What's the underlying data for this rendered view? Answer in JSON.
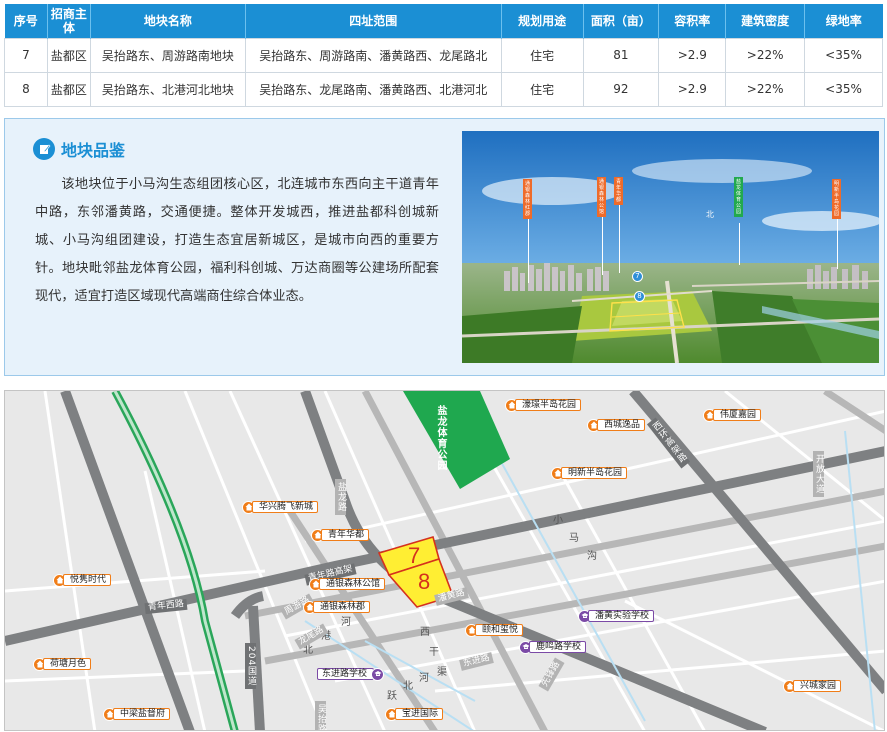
{
  "table": {
    "headers": [
      "序号",
      "招商主体",
      "地块名称",
      "四址范围",
      "规划用途",
      "面积（亩）",
      "容积率",
      "建筑密度",
      "绿地率"
    ],
    "rows": [
      [
        "7",
        "盐都区",
        "吴抬路东、周游路南地块",
        "吴抬路东、周游路南、潘黄路西、龙尾路北",
        "住宅",
        "81",
        ">2.9",
        ">22%",
        "<35%"
      ],
      [
        "8",
        "盐都区",
        "吴抬路东、北港河北地块",
        "吴抬路东、龙尾路南、潘黄路西、北港河北",
        "住宅",
        "92",
        ">2.9",
        ">22%",
        "<35%"
      ]
    ]
  },
  "appraisal": {
    "title": "地块品鉴",
    "icon": "edit-note-icon",
    "text": "该地块位于小马沟生态组团核心区，北连城市东西向主干道青年中路，东邻潘黄路，交通便捷。整体开发城西，推进盐都科创城新城、小马沟组团建设，打造生态宜居新城区，是城市向西的重要方针。地块毗邻盐龙体育公园，福利科创城、万达商圈等公建场所配套现代，适宜打造区域现代高端商住综合体业态。",
    "aerial": {
      "tags": [
        "通银森林红郡",
        "通银森林公馆",
        "青年华都",
        "盐龙体育公园",
        "明新半岛花园"
      ],
      "north": "北",
      "pins": [
        "7",
        "8"
      ]
    }
  },
  "map": {
    "plots": [
      "7",
      "8"
    ],
    "park": "盐龙体育公园",
    "river": [
      "小",
      "马",
      "沟"
    ],
    "river2": [
      "北",
      "港",
      "河"
    ],
    "river3": [
      "西",
      "干",
      "渠"
    ],
    "river4": [
      "跃",
      "北",
      "河"
    ],
    "roads": {
      "qingnian_zhong": "青年路高架",
      "qingnian_west": "青年西路",
      "zhouyou": "周游路",
      "longwei": "龙尾路",
      "pinghuang": "潘黄路",
      "dongjin": "东进路",
      "panhuang": "潘黄路",
      "g204": "204国道",
      "yanlong": "盐龙路",
      "west_ring": "西环高架路",
      "wutai": "吴抬路",
      "xiaodong": "东进路",
      "e1": "开放大道",
      "e2": "东进路",
      "e3": "先锋路"
    },
    "pois": [
      {
        "name": "濠璟半岛花园",
        "type": "home"
      },
      {
        "name": "西城逸品",
        "type": "home"
      },
      {
        "name": "伟厦嘉园",
        "type": "home"
      },
      {
        "name": "明新半岛花园",
        "type": "home"
      },
      {
        "name": "华兴腾飞新城",
        "type": "home"
      },
      {
        "name": "青年华都",
        "type": "home"
      },
      {
        "name": "通银森林公馆",
        "type": "home"
      },
      {
        "name": "通银森林郡",
        "type": "home"
      },
      {
        "name": "悦隽时代",
        "type": "home"
      },
      {
        "name": "潘黄实验学校",
        "type": "school"
      },
      {
        "name": "颐和玺悦",
        "type": "home"
      },
      {
        "name": "鹿鸣路学校",
        "type": "school"
      },
      {
        "name": "荷塘月色",
        "type": "home"
      },
      {
        "name": "东进路学校",
        "type": "school"
      },
      {
        "name": "兴城家园",
        "type": "home"
      },
      {
        "name": "中梁盐督府",
        "type": "home"
      },
      {
        "name": "宝进国际",
        "type": "home"
      }
    ]
  }
}
